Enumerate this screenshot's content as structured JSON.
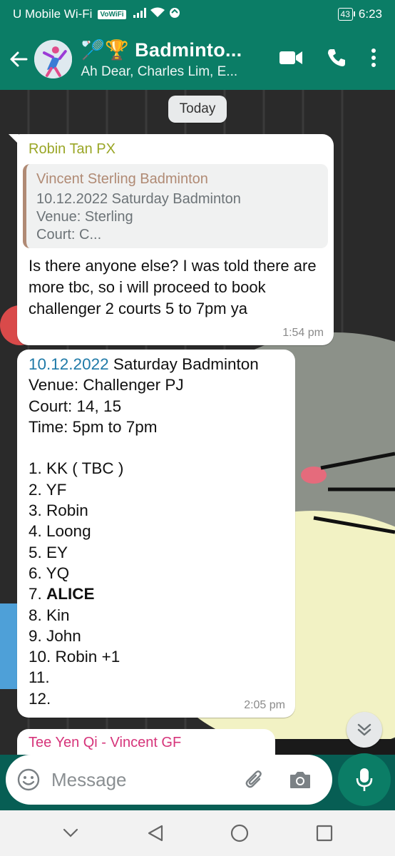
{
  "status_bar": {
    "carrier": "U Mobile Wi-Fi",
    "vowifi": "VoWiFi",
    "battery": "43",
    "time": "6:23"
  },
  "header": {
    "title": "🏸🏆 Badminto...",
    "subtitle": "Ah Dear, Charles Lim, E..."
  },
  "chat": {
    "date_pill": "Today",
    "messages": [
      {
        "sender": "Robin Tan PX",
        "quote": {
          "author": "Vincent Sterling Badminton",
          "lines": [
            "10.12.2022 Saturday Badminton",
            "Venue: Sterling",
            "Court: C..."
          ]
        },
        "text": "Is there anyone else? I was told there are more tbc, so i will proceed to book challenger 2 courts 5 to 7pm ya",
        "time": "1:54 pm"
      },
      {
        "date_link": "10.12.2022",
        "title_rest": " Saturday Badminton",
        "lines": [
          "Venue: Challenger PJ",
          "Court: 14, 15",
          "Time: 5pm to 7pm",
          "",
          "1. KK ( TBC )",
          "2. YF",
          "3. Robin",
          "4. Loong",
          "5. EY",
          "6. YQ"
        ],
        "bold_prefix": "7. ",
        "bold_name": "ALICE",
        "lines_after": [
          "8. Kin",
          "9. John",
          "10. Robin +1",
          "11.",
          "12."
        ],
        "time": "2:05 pm"
      },
      {
        "sender": "Tee Yen Qi - Vincent GF"
      }
    ]
  },
  "composer": {
    "placeholder": "Message"
  },
  "colors": {
    "brand": "#0b7d66",
    "sender1": "#9aa626",
    "quote_author": "#b08a74",
    "link": "#1f7aa8",
    "sender3": "#d6347a"
  }
}
